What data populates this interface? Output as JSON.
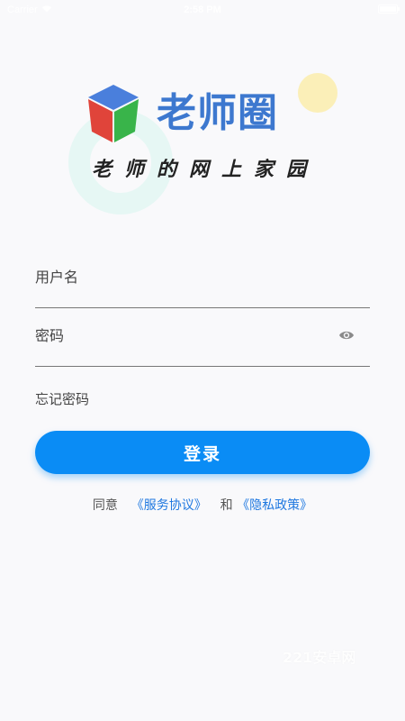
{
  "status_bar": {
    "carrier": "Carrier",
    "time": "2:58 PM",
    "battery_level": 1.0
  },
  "brand": {
    "name": "老师圈",
    "slogan": "老师的网上家园",
    "logo_icon": "cube-logo-icon",
    "colors": {
      "wordmark": "#3d78cf",
      "cube_top": "#4a7fdc",
      "cube_left": "#e0443a",
      "cube_right": "#39b44a",
      "ring": "#e6f7f4",
      "sun": "#fbefb8"
    }
  },
  "form": {
    "username_placeholder": "用户名",
    "password_placeholder": "密码",
    "password_toggle_icon": "eye-icon",
    "forgot_password": "忘记密码",
    "login_button": "登录",
    "accent_color": "#0a8cf5"
  },
  "agreement": {
    "prefix": "同意",
    "terms": "《服务协议》",
    "conjunction": "和",
    "privacy": "《隐私政策》",
    "link_color": "#1f78e0"
  },
  "watermark": "221安卓网"
}
